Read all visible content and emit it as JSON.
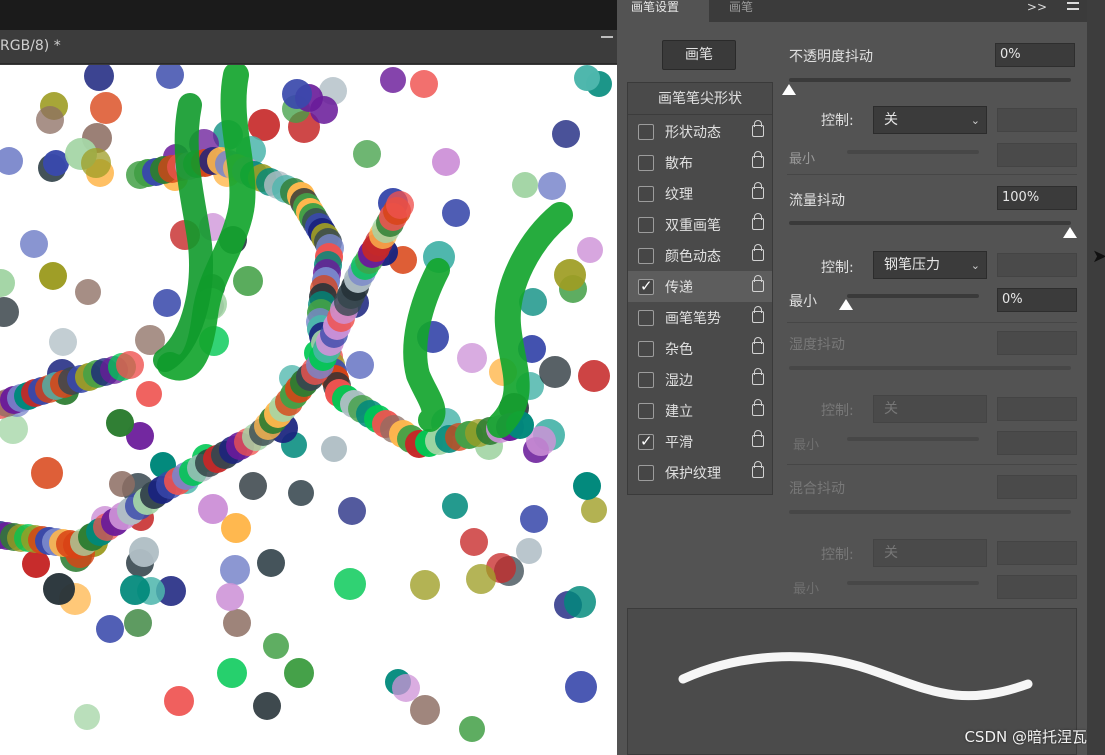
{
  "document": {
    "tab_title": "RGB/8) *"
  },
  "panel": {
    "tabs": [
      "画笔设置",
      "画笔"
    ],
    "menu_glyph": ">>",
    "preset_button": "画笔",
    "tip_shape_header": "画笔笔尖形状",
    "options": [
      {
        "label": "形状动态",
        "checked": false
      },
      {
        "label": "散布",
        "checked": false
      },
      {
        "label": "纹理",
        "checked": false
      },
      {
        "label": "双重画笔",
        "checked": false
      },
      {
        "label": "颜色动态",
        "checked": false
      },
      {
        "label": "传递",
        "checked": true
      },
      {
        "label": "画笔笔势",
        "checked": false
      },
      {
        "label": "杂色",
        "checked": false
      },
      {
        "label": "湿边",
        "checked": false
      },
      {
        "label": "建立",
        "checked": false
      },
      {
        "label": "平滑",
        "checked": true
      },
      {
        "label": "保护纹理",
        "checked": false
      }
    ],
    "transfer": {
      "opacity_jitter": {
        "label": "不透明度抖动",
        "value": "0%",
        "level": 0
      },
      "opacity_control": {
        "label": "控制:",
        "value": "关"
      },
      "opacity_min": {
        "label": "最小"
      },
      "flow_jitter": {
        "label": "流量抖动",
        "value": "100%",
        "level": 1
      },
      "flow_control": {
        "label": "控制:",
        "value": "钢笔压力"
      },
      "flow_min": {
        "label": "最小",
        "value": "0%",
        "level": 0
      },
      "wetness_jitter": {
        "label": "湿度抖动"
      },
      "wetness_control": {
        "label": "控制:",
        "value": "关"
      },
      "wetness_min": {
        "label": "最小"
      },
      "mix_jitter": {
        "label": "混合抖动"
      },
      "mix_control": {
        "label": "控制:",
        "value": "关"
      },
      "mix_min": {
        "label": "最小"
      }
    }
  },
  "watermark": "CSDN @暗托涅瓦",
  "colors": {
    "canvas": "#ffffff",
    "panel": "#535353",
    "stroke_green": "#14a52e"
  }
}
